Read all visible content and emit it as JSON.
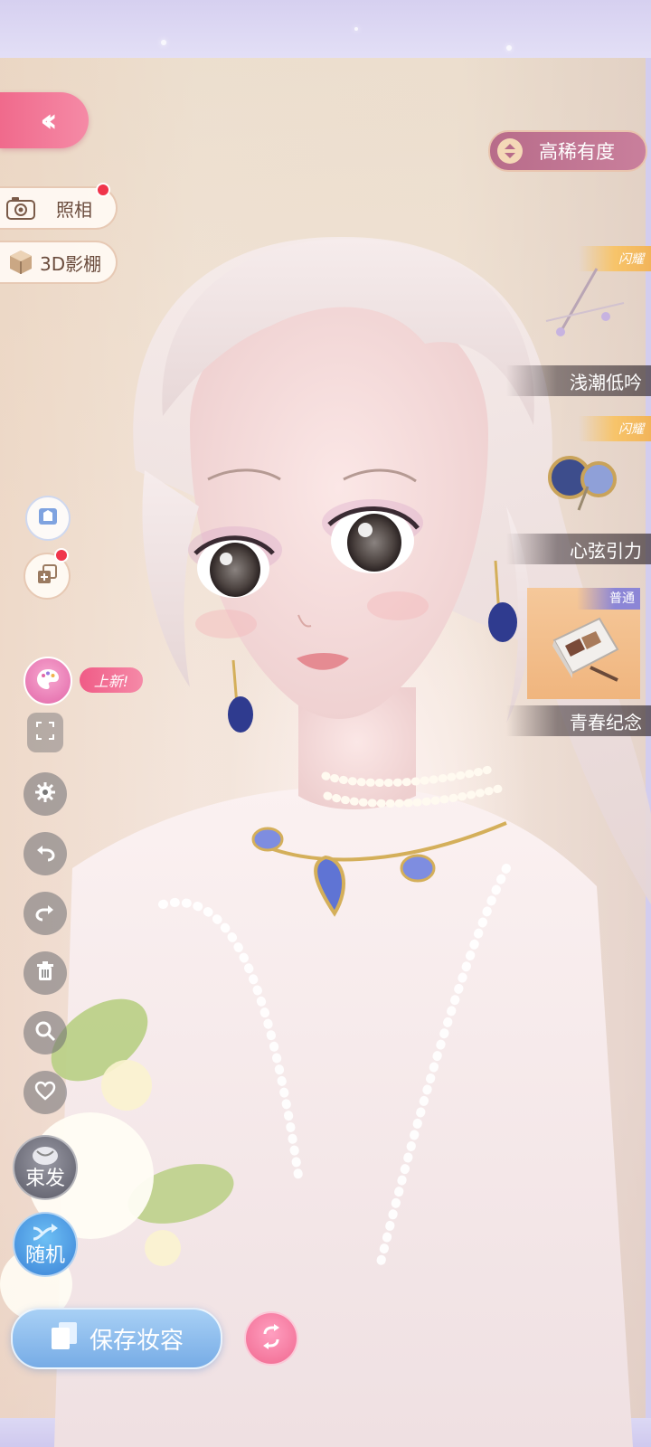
{
  "nav": {
    "back_icon": "double-chevron-left-icon",
    "photo_label": "照相",
    "studio_label": "3D影棚"
  },
  "mood": {
    "label": "高稀有度"
  },
  "items": [
    {
      "rarity": "闪耀",
      "name": "浅潮低吟"
    },
    {
      "rarity": "闪耀",
      "name": "心弦引力"
    },
    {
      "rarity": "普通",
      "name": "青春纪念"
    }
  ],
  "toolbar": {
    "new_badge": "上新!",
    "hairtie_label": "束发",
    "random_label": "随机",
    "icons": [
      "fullscreen-icon",
      "settings-icon",
      "undo-icon",
      "redo-icon",
      "delete-icon",
      "search-icon",
      "favorite-icon"
    ]
  },
  "footer": {
    "save_label": "保存妆容"
  },
  "colors": {
    "accent_pink": "#f06a8c",
    "save_blue": "#77ace6",
    "mood_mauve": "#b86c8a",
    "rarity_gold": "#f7c46a",
    "rarity_common": "#8c86d6"
  }
}
